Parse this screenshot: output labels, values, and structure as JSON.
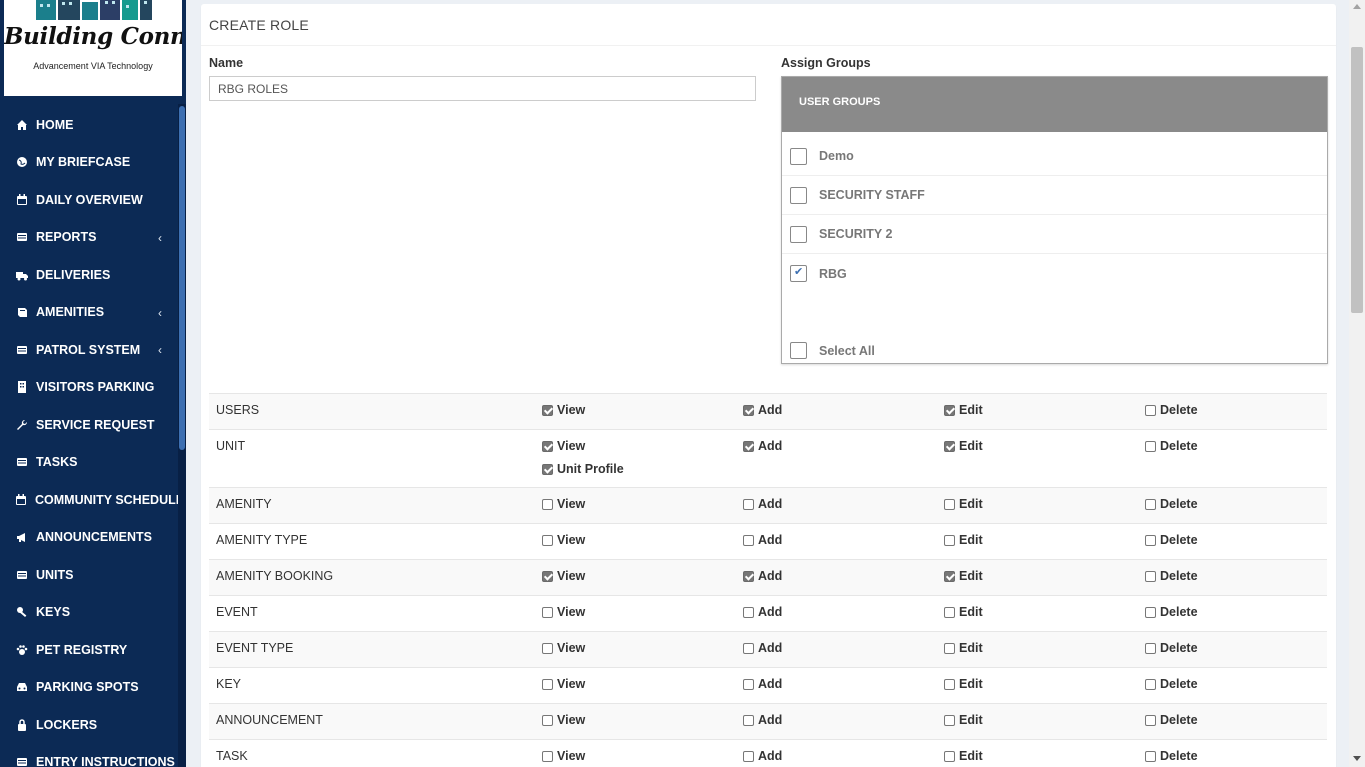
{
  "logo": {
    "brand": "Building Connect",
    "tagline": "Advancement VIA Technology"
  },
  "sidebar": {
    "items": [
      {
        "label": "HOME",
        "icon": "home-icon",
        "chevron": ""
      },
      {
        "label": "MY BRIEFCASE",
        "icon": "globe-icon",
        "chevron": ""
      },
      {
        "label": "DAILY OVERVIEW",
        "icon": "calendar-icon",
        "chevron": ""
      },
      {
        "label": "REPORTS",
        "icon": "list-icon",
        "chevron": "‹"
      },
      {
        "label": "DELIVERIES",
        "icon": "truck-icon",
        "chevron": ""
      },
      {
        "label": "AMENITIES",
        "icon": "book-icon",
        "chevron": "‹"
      },
      {
        "label": "PATROL SYSTEM",
        "icon": "list-icon",
        "chevron": "‹"
      },
      {
        "label": "VISITORS PARKING",
        "icon": "building-icon",
        "chevron": ""
      },
      {
        "label": "SERVICE REQUEST",
        "icon": "wrench-icon",
        "chevron": ""
      },
      {
        "label": "TASKS",
        "icon": "list-icon",
        "chevron": ""
      },
      {
        "label": "COMMUNITY SCHEDULE",
        "icon": "calendar-icon",
        "chevron": ""
      },
      {
        "label": "ANNOUNCEMENTS",
        "icon": "bullhorn-icon",
        "chevron": ""
      },
      {
        "label": "UNITS",
        "icon": "list-icon",
        "chevron": ""
      },
      {
        "label": "KEYS",
        "icon": "key-icon",
        "chevron": ""
      },
      {
        "label": "PET REGISTRY",
        "icon": "paw-icon",
        "chevron": ""
      },
      {
        "label": "PARKING SPOTS",
        "icon": "car-icon",
        "chevron": ""
      },
      {
        "label": "LOCKERS",
        "icon": "lock-icon",
        "chevron": ""
      },
      {
        "label": "ENTRY INSTRUCTIONS",
        "icon": "list-icon",
        "chevron": ""
      }
    ]
  },
  "page": {
    "title": "CREATE ROLE",
    "name_label": "Name",
    "name_value": "RBG ROLES",
    "assign_label": "Assign Groups",
    "groups_header": "USER GROUPS",
    "groups": [
      {
        "label": "Demo",
        "checked": false
      },
      {
        "label": "SECURITY STAFF",
        "checked": false
      },
      {
        "label": "SECURITY 2",
        "checked": false
      },
      {
        "label": "RBG",
        "checked": true
      }
    ],
    "select_all": "Select All"
  },
  "permissions": {
    "labels": {
      "view": "View",
      "add": "Add",
      "edit": "Edit",
      "delete": "Delete",
      "unit_profile": "Unit Profile"
    },
    "rows": [
      {
        "name": "USERS",
        "view": true,
        "add": true,
        "edit": true,
        "delete": false
      },
      {
        "name": "UNIT",
        "view": true,
        "add": true,
        "edit": true,
        "delete": false,
        "unit_profile": true
      },
      {
        "name": "AMENITY",
        "view": false,
        "add": false,
        "edit": false,
        "delete": false
      },
      {
        "name": "AMENITY TYPE",
        "view": false,
        "add": false,
        "edit": false,
        "delete": false
      },
      {
        "name": "AMENITY BOOKING",
        "view": true,
        "add": true,
        "edit": true,
        "delete": false
      },
      {
        "name": "EVENT",
        "view": false,
        "add": false,
        "edit": false,
        "delete": false
      },
      {
        "name": "EVENT TYPE",
        "view": false,
        "add": false,
        "edit": false,
        "delete": false
      },
      {
        "name": "KEY",
        "view": false,
        "add": false,
        "edit": false,
        "delete": false
      },
      {
        "name": "ANNOUNCEMENT",
        "view": false,
        "add": false,
        "edit": false,
        "delete": false
      },
      {
        "name": "TASK",
        "view": false,
        "add": false,
        "edit": false,
        "delete": false
      }
    ]
  },
  "colors": {
    "sidebar_bg": "#0c2a55",
    "groups_header_bg": "#8a8a8a",
    "accent": "#3d6fb1"
  }
}
